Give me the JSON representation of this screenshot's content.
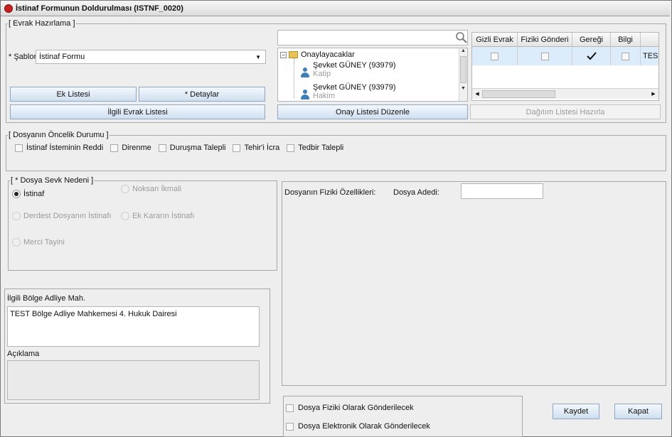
{
  "window": {
    "title": "İstinaf Formunun Doldurulması (ISTNF_0020)"
  },
  "evrak": {
    "legend": "[ Evrak Hazırlama ]",
    "sablon_label": "* Şablon",
    "sablon_value": "İstinaf Formu",
    "ek_listesi": "Ek Listesi",
    "detaylar": "* Detaylar",
    "ilgili_evrak": "İlgili Evrak Listesi",
    "tree_root": "Onaylayacaklar",
    "approvers": [
      {
        "name": "Şevket GÜNEY (93979)",
        "role": "Katip"
      },
      {
        "name": "Şevket GÜNEY (93979)",
        "role": "Hakim"
      }
    ],
    "onay_listesi": "Onay Listesi Düzenle",
    "dagitim_listesi": "Dağıtım Listesi Hazırla",
    "grid_headers": [
      "Gizli Evrak",
      "Fiziki Gönderi",
      "Gereği",
      "Bilgi",
      ""
    ],
    "grid_row_last": "TEST"
  },
  "oncelik": {
    "legend": "[ Dosyanın Öncelik Durumu ]",
    "items": [
      "İstinaf İsteminin Reddi",
      "Direnme",
      "Duruşma Talepli",
      "Tehir'i İcra",
      "Tedbir Talepli"
    ]
  },
  "sevk": {
    "legend": "[ * Dosya Sevk Nedeni ]",
    "options": [
      "İstinaf",
      "Noksan İkmali",
      "Derdest Dosyanın İstinafı",
      "Ek Kararın İstinafı",
      "Merci Tayini"
    ]
  },
  "fiziki": {
    "ozellik_label": "Dosyanın Fiziki Özellikleri:",
    "adet_label": "Dosya Adedi:",
    "adet_value": ""
  },
  "bolge": {
    "label": "İlgili Bölge Adliye Mah.",
    "value": "TEST Bölge Adliye Mahkemesi 4. Hukuk Dairesi",
    "aciklama_label": "Açıklama"
  },
  "gonderim": {
    "fiziki": "Dosya Fiziki Olarak Gönderilecek",
    "elektronik": "Dosya Elektronik Olarak Gönderilecek"
  },
  "actions": {
    "kaydet": "Kaydet",
    "kapat": "Kapat"
  },
  "icons": {
    "logo": "app-logo-icon",
    "search": "search-icon",
    "folder": "folder-icon",
    "person": "person-icon",
    "check": "check-icon"
  }
}
